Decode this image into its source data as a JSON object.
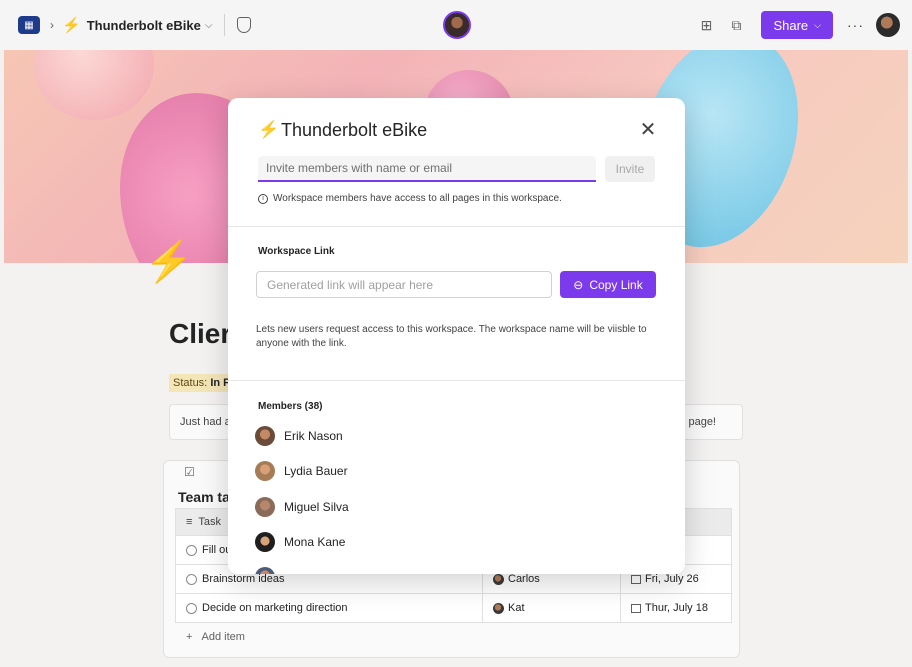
{
  "topbar": {
    "workspace_name": "Thunderbolt eBike",
    "share_label": "Share",
    "more_label": "···"
  },
  "page": {
    "title": "Clier",
    "status_label": "Status:",
    "status_value": "In P",
    "callout_text": "Just had a",
    "callout_tail": "s page!",
    "task_card_title": "Team ta",
    "table": {
      "headers": [
        "Task",
        "",
        "te"
      ],
      "rows": [
        {
          "task": "Fill ou",
          "owner": "",
          "date": "23"
        },
        {
          "task": "Brainstorm ideas",
          "owner": "Carlos",
          "date": "Fri, July 26"
        },
        {
          "task": "Decide on marketing direction",
          "owner": "Kat",
          "date": "Thur, July 18"
        }
      ]
    },
    "add_item": "Add item"
  },
  "modal": {
    "title": "Thunderbolt eBike",
    "invite_placeholder": "Invite members with name or email",
    "invite_button": "Invite",
    "info_text": "Workspace members have access to all pages in this workspace.",
    "link_section_label": "Workspace Link",
    "link_placeholder": "Generated link will appear here",
    "copy_button": "Copy Link",
    "link_description": "Lets new users request access to this workspace. The workspace name will be viisble to anyone with the link.",
    "members_label": "Members (38)",
    "members": [
      {
        "name": "Erik Nason"
      },
      {
        "name": "Lydia Bauer"
      },
      {
        "name": "Miguel Silva"
      },
      {
        "name": "Mona Kane"
      },
      {
        "name": ""
      }
    ]
  },
  "colors": {
    "accent": "#7c3aed",
    "bolt": "#f97316",
    "status_bg": "#f5e6b8"
  }
}
